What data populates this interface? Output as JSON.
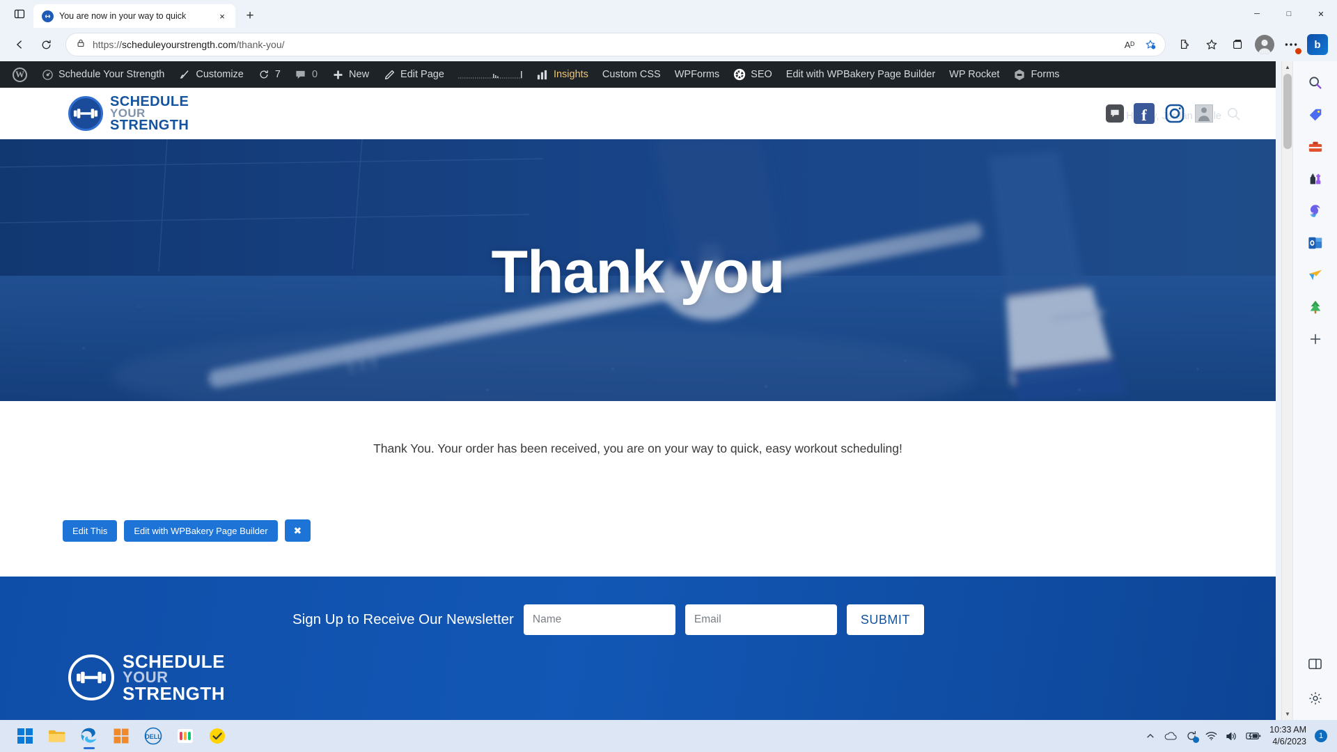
{
  "browser": {
    "tab": {
      "title": "You are now in your way to quick",
      "favicon": "link-icon",
      "close": "×",
      "new_tab": "+"
    },
    "tab_list_button": "tab-actions-icon",
    "window_controls": {
      "minimize": "─",
      "maximize": "□",
      "close": "✕"
    },
    "nav": {
      "back": "←",
      "refresh": "⟳"
    },
    "omnibox": {
      "lock": "lock-icon",
      "url_prefix": "https://",
      "url_bold": "scheduleyourstrength.com",
      "url_suffix": "/thank-you/",
      "read_aloud": "Aᴰ",
      "favorites_add": "favorite-star-icon",
      "extensions": "puzzle-icon",
      "favorites": "star-icon",
      "collections": "collections-icon",
      "profile": "profile-avatar",
      "settings_more": "ellipsis-icon",
      "copilot": "b"
    }
  },
  "wp_admin_bar": {
    "items": [
      {
        "icon": "wordpress-logo-icon",
        "label": ""
      },
      {
        "icon": "dashboard-icon",
        "label": "Schedule Your Strength"
      },
      {
        "icon": "brush-icon",
        "label": "Customize"
      },
      {
        "icon": "updates-icon",
        "label": "7"
      },
      {
        "icon": "comment-icon",
        "label": "0"
      },
      {
        "icon": "plus-icon",
        "label": "New"
      },
      {
        "icon": "pencil-icon",
        "label": "Edit Page"
      },
      {
        "icon": "sparkline-graph",
        "label": ""
      },
      {
        "icon": "bar-chart-icon",
        "label": "Insights"
      },
      {
        "icon": "",
        "label": "Custom CSS"
      },
      {
        "icon": "",
        "label": "WPForms"
      },
      {
        "icon": "seo-gear-icon",
        "label": "SEO"
      },
      {
        "icon": "",
        "label": "Edit with WPBakery Page Builder"
      },
      {
        "icon": "",
        "label": "WP Rocket"
      },
      {
        "icon": "gravity-forms-icon",
        "label": "Forms"
      }
    ]
  },
  "site": {
    "logo": {
      "line1": "SCHEDULE",
      "line2": "YOUR",
      "line3": "STRENGTH",
      "icon": "dumbbell-icon"
    },
    "howdy": "Howdy, Jordan Keple",
    "header_icons": {
      "chat": "chat-bubble-icon",
      "facebook": "f",
      "instagram": "instagram-icon",
      "avatar": "user-avatar-icon",
      "search": "search-icon"
    },
    "hero": {
      "title": "Thank you"
    },
    "message": "Thank You. Your order has been received, you are on your way to quick, easy workout scheduling!",
    "edit_buttons": {
      "edit_this": "Edit This",
      "edit_wpbakery": "Edit with WPBakery Page Builder",
      "close": "✖"
    },
    "newsletter": {
      "label": "Sign Up to Receive Our Newsletter",
      "name_placeholder": "Name",
      "name_value": "",
      "email_placeholder": "Email",
      "email_value": "",
      "submit": "SUBMIT"
    },
    "footer_logo": {
      "line1": "SCHEDULE",
      "line2": "YOUR",
      "line3": "STRENGTH",
      "icon": "dumbbell-icon"
    }
  },
  "edge_sidebar": {
    "icons": [
      "search-icon",
      "shopping-tag-icon",
      "tools-icon",
      "games-icon",
      "copilot-icon",
      "outlook-icon",
      "send-icon",
      "tree-icon",
      "add-icon"
    ],
    "bottom": [
      "split-screen-icon",
      "settings-gear-icon"
    ]
  },
  "taskbar": {
    "apps": [
      "start-windows-icon",
      "file-explorer-icon",
      "edge-browser-icon",
      "microsoft-store-icon",
      "dell-icon",
      "monday-icon",
      "todo-check-icon"
    ],
    "tray": {
      "chevron": "show-hidden-icons-icon",
      "onedrive": "onedrive-cloud-icon",
      "update": "windows-update-icon",
      "wifi": "wifi-icon",
      "volume": "speaker-icon",
      "battery": "battery-charging-icon",
      "time": "10:33 AM",
      "date": "4/6/2023",
      "notification_count": "1"
    }
  },
  "colors": {
    "accent_blue": "#1e73d6",
    "brand_blue": "#14539e",
    "footer_blue": "#0f4ea8",
    "wp_bar": "#1d2327"
  }
}
